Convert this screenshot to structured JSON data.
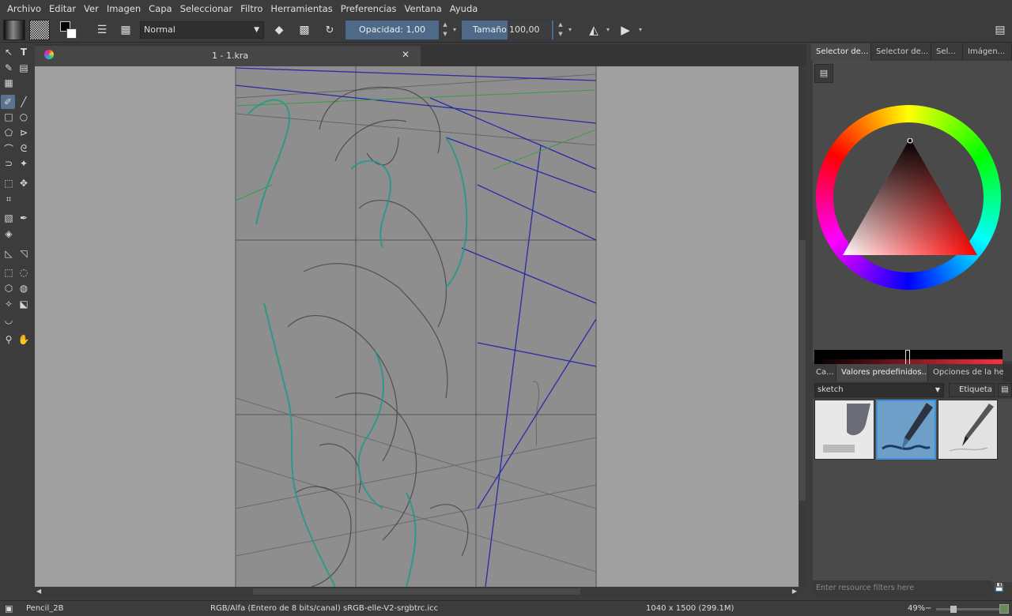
{
  "menu": [
    "Archivo",
    "Editar",
    "Ver",
    "Imagen",
    "Capa",
    "Seleccionar",
    "Filtro",
    "Herramientas",
    "Preferencias",
    "Ventana",
    "Ayuda"
  ],
  "options": {
    "blend_mode": "Normal",
    "opacity_label": "Opacidad:",
    "opacity_value": "1,00",
    "size_label": "Tamaño:",
    "size_value": "100,00 px"
  },
  "document": {
    "tab_title": "1 - 1.kra"
  },
  "right_panel": {
    "top_tabs": [
      "Selector de...",
      "Selector de...",
      "Sel...",
      "Imágen..."
    ],
    "preset_tabs": [
      "Ca...",
      "Valores predefinidos...",
      "Opciones de la he..."
    ],
    "preset_tag": "sketch",
    "tag_button": "Etiqueta",
    "filter_placeholder": "Enter resource filters here"
  },
  "status": {
    "preset_name": "Pencil_2B",
    "color_space": "RGB/Alfa (Entero de 8 bits/canal)  sRGB-elle-V2-srgbtrc.icc",
    "dimensions": "1040 x 1500 (299.1M)",
    "zoom": "49%",
    "zoom_level": 0.49
  },
  "colors": {
    "accent": "#5a7391",
    "canvas": "#a0a0a0",
    "sketch_teal": "#1f9a8a",
    "perspective_blue": "#2b2aa8"
  }
}
